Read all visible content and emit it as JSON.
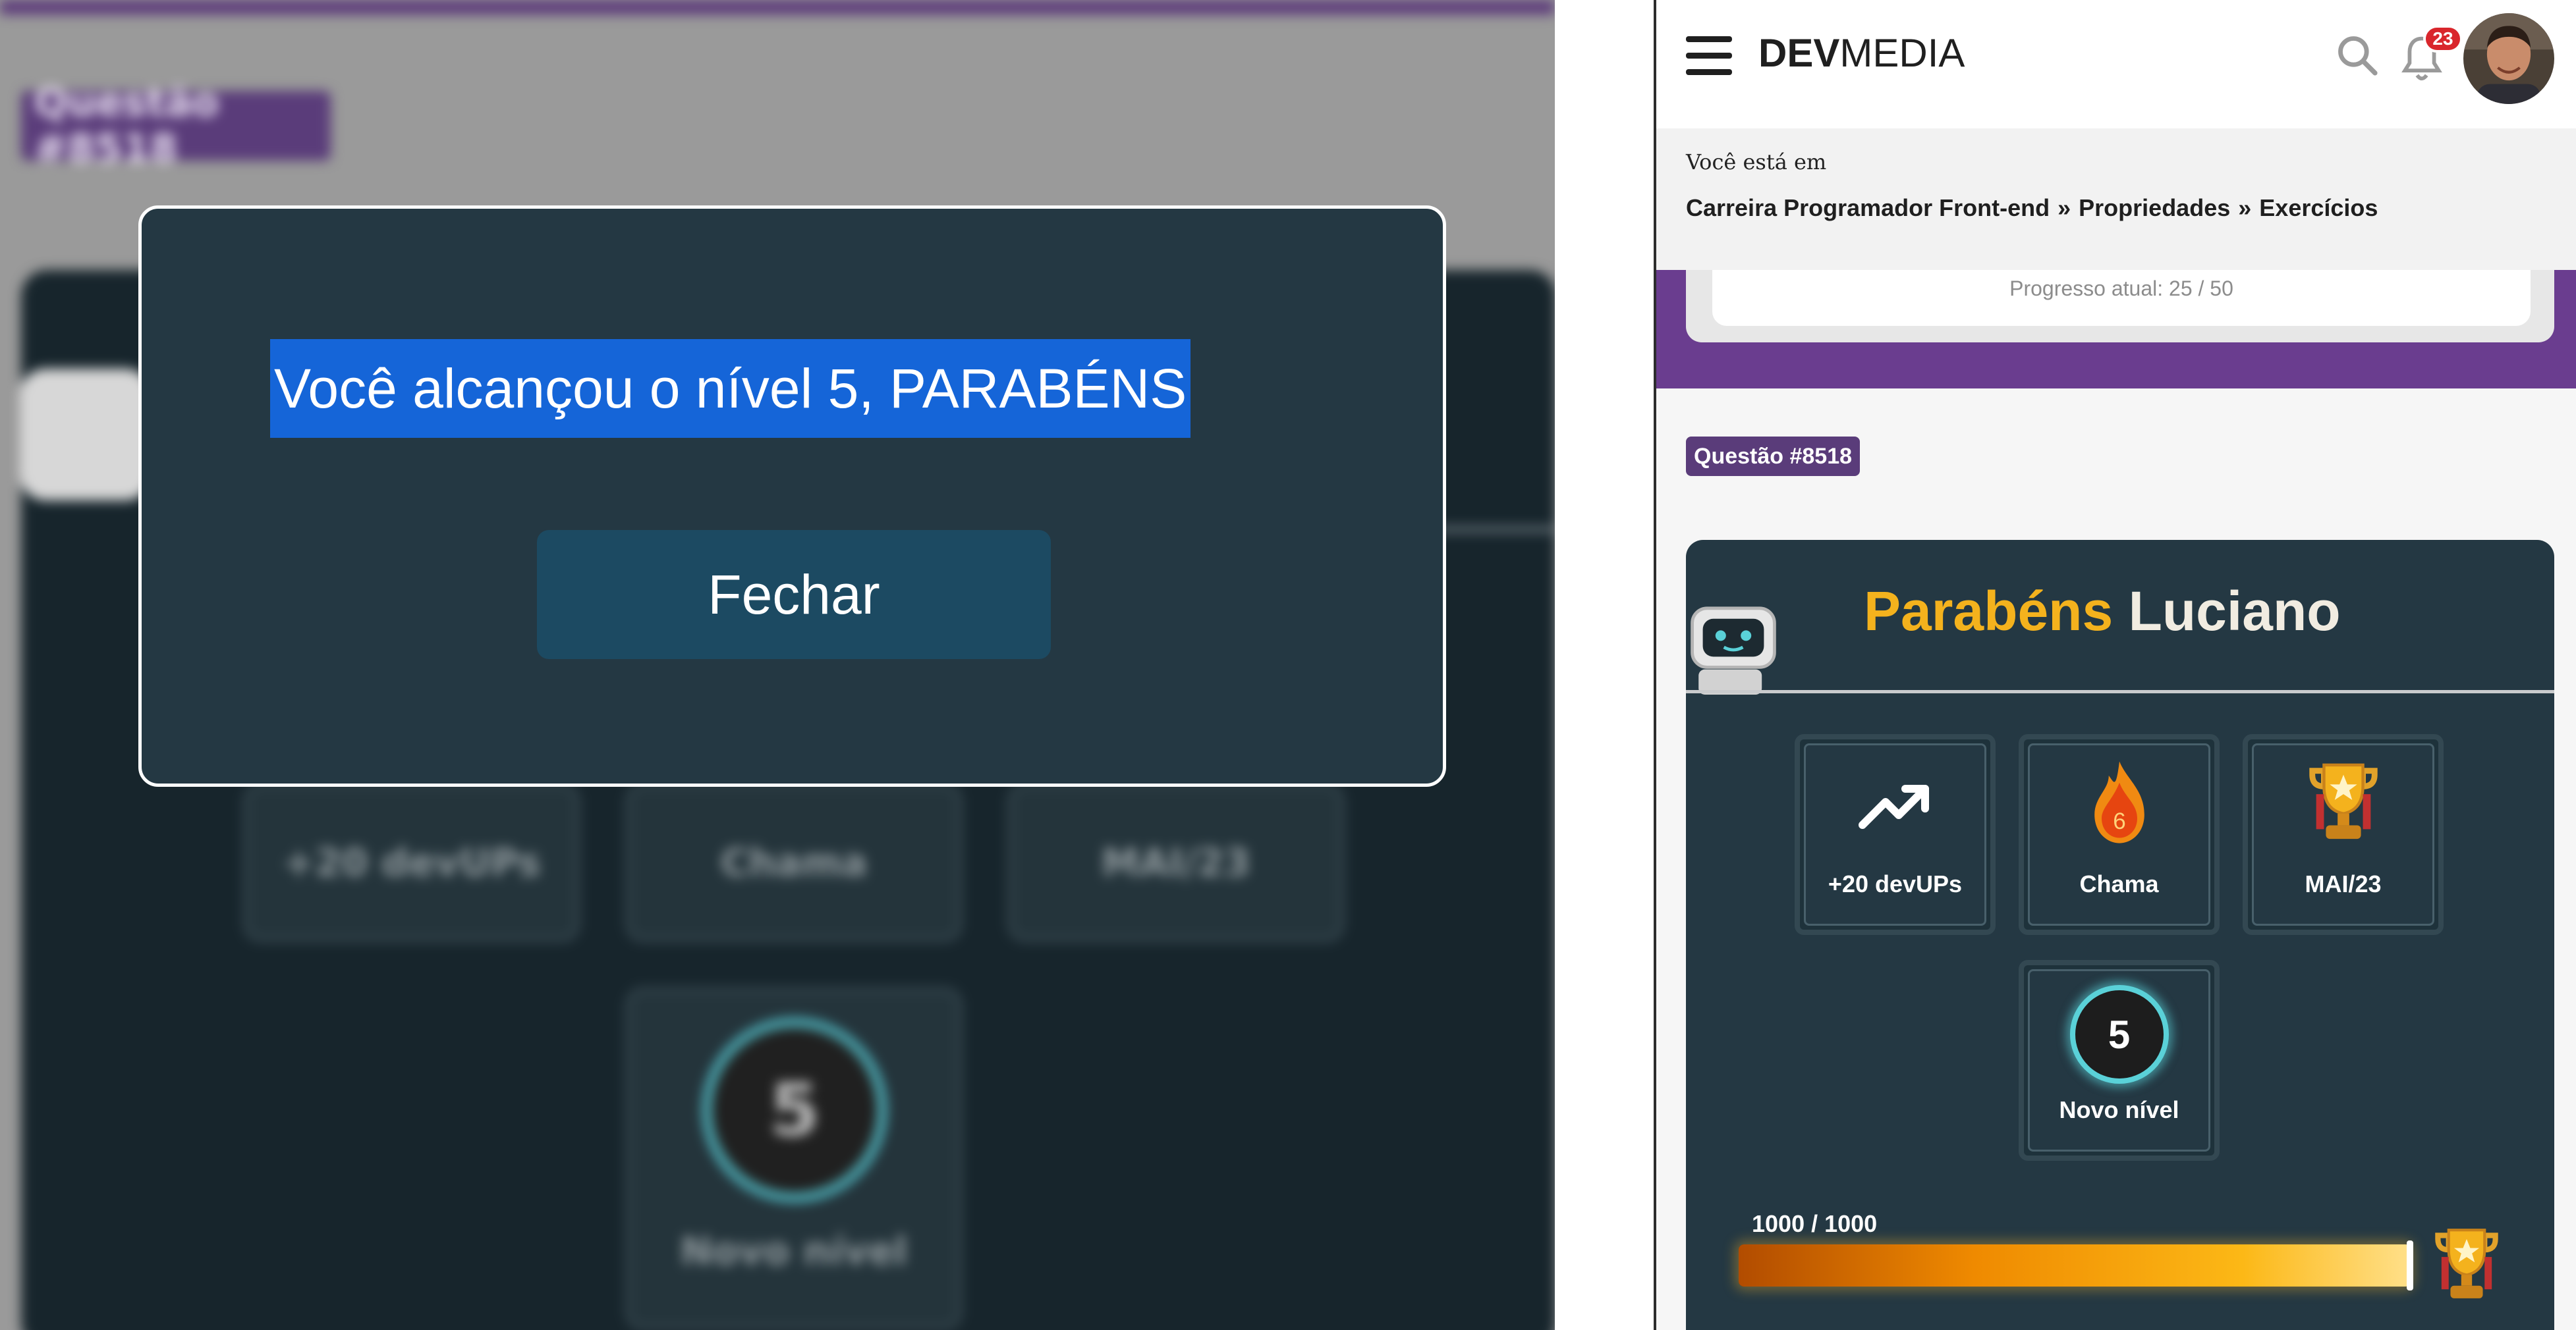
{
  "modal": {
    "message": "Você alcançou o nível 5, PARABÉNS",
    "close_label": "Fechar"
  },
  "background": {
    "question_tag": "Questão #8518",
    "tiles": [
      "+20 devUPs",
      "Chama",
      "MAI/23"
    ],
    "level_value": "5",
    "level_label": "Novo nível"
  },
  "header": {
    "brand_bold": "DEV",
    "brand_light": "MEDIA",
    "notification_count": "23"
  },
  "breadcrumb": {
    "intro": "Você está em",
    "items": [
      "Carreira Programador Front-end",
      "Propriedades",
      "Exercícios"
    ],
    "separator": "»"
  },
  "progress": {
    "text": "Progresso atual: 25 / 50"
  },
  "question": {
    "tag": "Questão #8518"
  },
  "result": {
    "congrats_word": "Parabéns",
    "user_name": "Luciano",
    "tiles": [
      {
        "label": "+20 devUPs",
        "icon": "trending-up-icon"
      },
      {
        "label": "Chama",
        "icon": "flame-icon",
        "value": "6"
      },
      {
        "label": "MAI/23",
        "icon": "trophy-icon"
      }
    ],
    "level": {
      "value": "5",
      "label": "Novo nível"
    },
    "xp": {
      "label": "1000 / 1000",
      "current": 1000,
      "max": 1000
    }
  },
  "colors": {
    "accent_purple": "#6a3d8f",
    "card_bg": "#243843",
    "gold": "#f4b21d",
    "selection_blue": "#1565d8"
  }
}
